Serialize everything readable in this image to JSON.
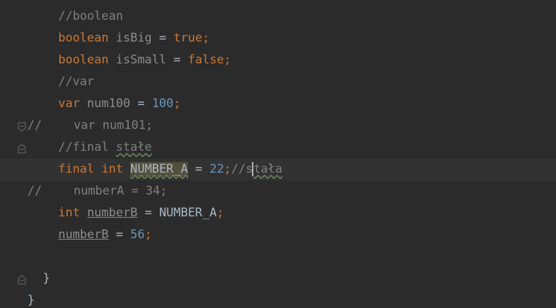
{
  "editor": {
    "lines": [
      {
        "indent": "    ",
        "parts": [
          {
            "t": "//boolean",
            "c": "cm"
          }
        ]
      },
      {
        "indent": "    ",
        "parts": [
          {
            "t": "boolean",
            "c": "kw"
          },
          {
            "t": " isBig",
            "c": "var"
          },
          {
            "t": " = ",
            "c": "op"
          },
          {
            "t": "true",
            "c": "kw"
          },
          {
            "t": ";",
            "c": "punc"
          }
        ]
      },
      {
        "indent": "    ",
        "parts": [
          {
            "t": "boolean",
            "c": "kw"
          },
          {
            "t": " isSmall",
            "c": "var"
          },
          {
            "t": " = ",
            "c": "op"
          },
          {
            "t": "false",
            "c": "kw"
          },
          {
            "t": ";",
            "c": "punc"
          }
        ]
      },
      {
        "indent": "    ",
        "parts": [
          {
            "t": "//var",
            "c": "cm"
          }
        ]
      },
      {
        "indent": "    ",
        "parts": [
          {
            "t": "var",
            "c": "kw"
          },
          {
            "t": " num100",
            "c": "var"
          },
          {
            "t": " = ",
            "c": "op"
          },
          {
            "t": "100",
            "c": "num"
          },
          {
            "t": ";",
            "c": "punc"
          }
        ]
      },
      {
        "linecomment": "//",
        "indent": "      ",
        "parts": [
          {
            "t": "var num101;",
            "c": "cm"
          }
        ]
      },
      {
        "indent": "    ",
        "parts": [
          {
            "t": "//final ",
            "c": "cm"
          },
          {
            "t": "stałe",
            "c": "cm typo"
          }
        ]
      },
      {
        "current": true,
        "indent": "    ",
        "parts": [
          {
            "t": "final",
            "c": "kw"
          },
          {
            "t": " ",
            "c": "op"
          },
          {
            "t": "int",
            "c": "kw"
          },
          {
            "t": " ",
            "c": "op"
          },
          {
            "t": "NUMBER_A",
            "c": "const hl typo"
          },
          {
            "t": " = ",
            "c": "op"
          },
          {
            "t": "22",
            "c": "num"
          },
          {
            "t": ";",
            "c": "punc"
          },
          {
            "t": "//s",
            "c": "cm"
          },
          {
            "t": "",
            "c": "cursor"
          },
          {
            "t": "tała",
            "c": "cm typo"
          }
        ]
      },
      {
        "linecomment": "//",
        "indent": "      ",
        "parts": [
          {
            "t": "numberA = 34;",
            "c": "cm"
          }
        ]
      },
      {
        "indent": "    ",
        "parts": [
          {
            "t": "int",
            "c": "kw"
          },
          {
            "t": " ",
            "c": "op"
          },
          {
            "t": "numberB",
            "c": "var ul"
          },
          {
            "t": " = ",
            "c": "op"
          },
          {
            "t": "NUMBER_A",
            "c": "const"
          },
          {
            "t": ";",
            "c": "punc"
          }
        ]
      },
      {
        "indent": "    ",
        "parts": [
          {
            "t": "numberB",
            "c": "var ul"
          },
          {
            "t": " = ",
            "c": "op"
          },
          {
            "t": "56",
            "c": "num"
          },
          {
            "t": ";",
            "c": "punc"
          }
        ]
      },
      {
        "indent": "",
        "parts": []
      },
      {
        "indent": "  ",
        "parts": [
          {
            "t": "}",
            "c": "brace"
          }
        ]
      },
      {
        "indent": "",
        "parts": [
          {
            "t": "}",
            "c": "brace"
          }
        ]
      }
    ]
  },
  "gutter": {
    "fold_icons": [
      {
        "line": 5,
        "name": "fold-start-icon"
      },
      {
        "line": 6,
        "name": "fold-end-icon"
      },
      {
        "line": 12,
        "name": "fold-end-icon"
      }
    ]
  },
  "colors": {
    "background": "#2b2b2b",
    "keyword": "#cc7832",
    "number": "#6897bb",
    "comment": "#808080",
    "identifier": "#a9b7c6"
  }
}
